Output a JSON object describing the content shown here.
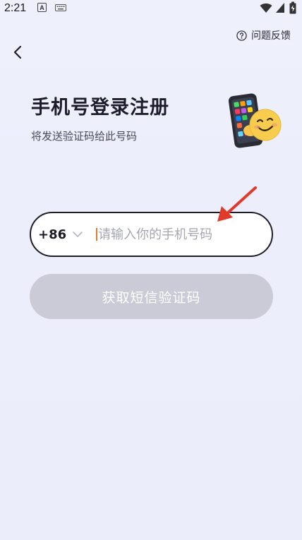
{
  "status_bar": {
    "time": "2:21",
    "notification_letter": "A",
    "icons": [
      "keyboard-icon",
      "wifi-icon",
      "signal-icon",
      "battery-icon"
    ]
  },
  "header": {
    "back_icon": "chevron-left-icon",
    "feedback_label": "问题反馈",
    "feedback_icon": "question-circle-icon"
  },
  "main": {
    "title": "手机号登录注册",
    "subtitle": "将发送验证码给此号码",
    "illustration": "phone-with-emoji-face"
  },
  "form": {
    "country_code": "+86",
    "country_chevron_icon": "chevron-down-icon",
    "phone_value": "",
    "phone_placeholder": "请输入你的手机号码",
    "submit_label": "获取短信验证码",
    "submit_enabled": false
  },
  "colors": {
    "background": "#eceefb",
    "input_border": "#1d1d28",
    "button_disabled": "#cacbd6",
    "caret": "#e07a33",
    "annotation_arrow": "#e03a2a"
  }
}
